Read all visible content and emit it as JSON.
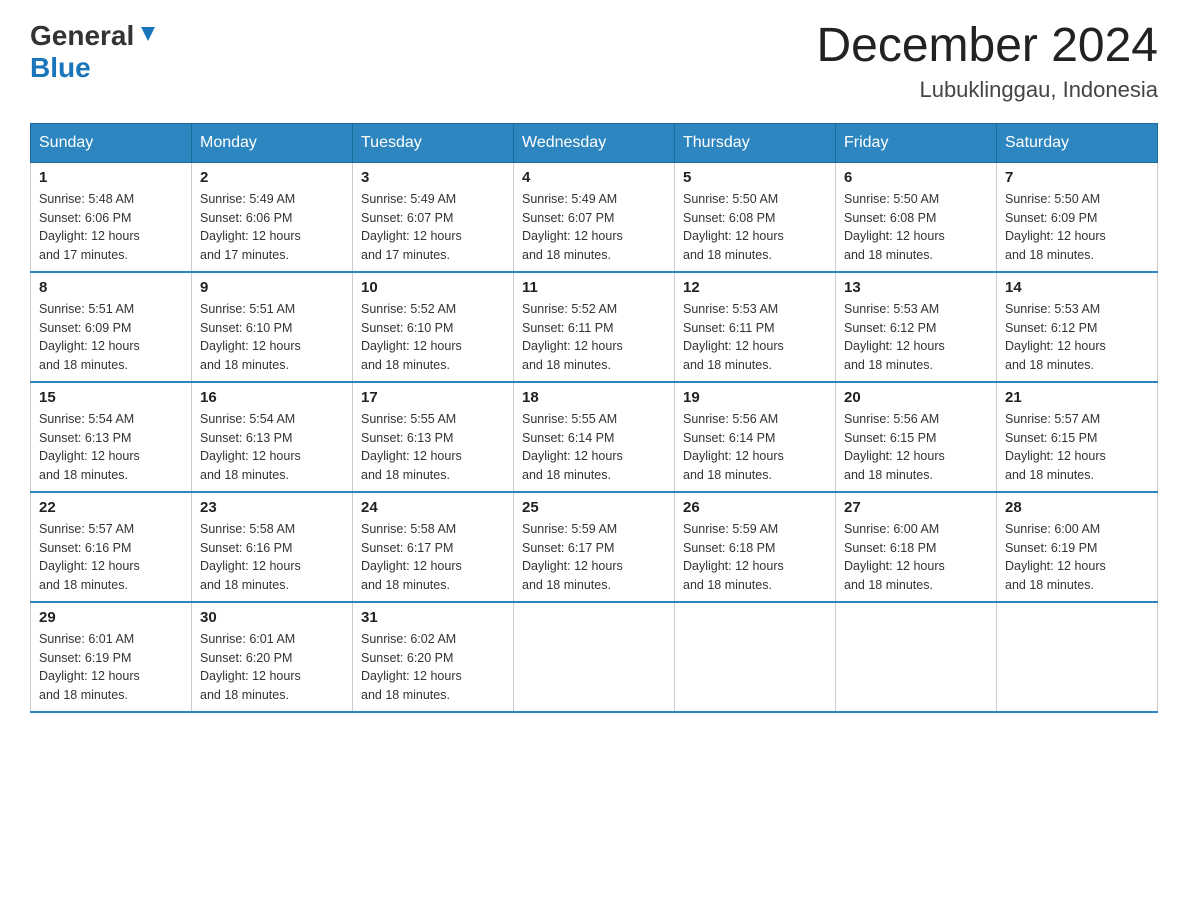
{
  "header": {
    "logo_general": "General",
    "logo_blue": "Blue",
    "month_year": "December 2024",
    "location": "Lubuklinggau, Indonesia"
  },
  "days_of_week": [
    "Sunday",
    "Monday",
    "Tuesday",
    "Wednesday",
    "Thursday",
    "Friday",
    "Saturday"
  ],
  "weeks": [
    [
      {
        "day": 1,
        "sunrise": "5:48 AM",
        "sunset": "6:06 PM",
        "daylight": "12 hours and 17 minutes."
      },
      {
        "day": 2,
        "sunrise": "5:49 AM",
        "sunset": "6:06 PM",
        "daylight": "12 hours and 17 minutes."
      },
      {
        "day": 3,
        "sunrise": "5:49 AM",
        "sunset": "6:07 PM",
        "daylight": "12 hours and 17 minutes."
      },
      {
        "day": 4,
        "sunrise": "5:49 AM",
        "sunset": "6:07 PM",
        "daylight": "12 hours and 18 minutes."
      },
      {
        "day": 5,
        "sunrise": "5:50 AM",
        "sunset": "6:08 PM",
        "daylight": "12 hours and 18 minutes."
      },
      {
        "day": 6,
        "sunrise": "5:50 AM",
        "sunset": "6:08 PM",
        "daylight": "12 hours and 18 minutes."
      },
      {
        "day": 7,
        "sunrise": "5:50 AM",
        "sunset": "6:09 PM",
        "daylight": "12 hours and 18 minutes."
      }
    ],
    [
      {
        "day": 8,
        "sunrise": "5:51 AM",
        "sunset": "6:09 PM",
        "daylight": "12 hours and 18 minutes."
      },
      {
        "day": 9,
        "sunrise": "5:51 AM",
        "sunset": "6:10 PM",
        "daylight": "12 hours and 18 minutes."
      },
      {
        "day": 10,
        "sunrise": "5:52 AM",
        "sunset": "6:10 PM",
        "daylight": "12 hours and 18 minutes."
      },
      {
        "day": 11,
        "sunrise": "5:52 AM",
        "sunset": "6:11 PM",
        "daylight": "12 hours and 18 minutes."
      },
      {
        "day": 12,
        "sunrise": "5:53 AM",
        "sunset": "6:11 PM",
        "daylight": "12 hours and 18 minutes."
      },
      {
        "day": 13,
        "sunrise": "5:53 AM",
        "sunset": "6:12 PM",
        "daylight": "12 hours and 18 minutes."
      },
      {
        "day": 14,
        "sunrise": "5:53 AM",
        "sunset": "6:12 PM",
        "daylight": "12 hours and 18 minutes."
      }
    ],
    [
      {
        "day": 15,
        "sunrise": "5:54 AM",
        "sunset": "6:13 PM",
        "daylight": "12 hours and 18 minutes."
      },
      {
        "day": 16,
        "sunrise": "5:54 AM",
        "sunset": "6:13 PM",
        "daylight": "12 hours and 18 minutes."
      },
      {
        "day": 17,
        "sunrise": "5:55 AM",
        "sunset": "6:13 PM",
        "daylight": "12 hours and 18 minutes."
      },
      {
        "day": 18,
        "sunrise": "5:55 AM",
        "sunset": "6:14 PM",
        "daylight": "12 hours and 18 minutes."
      },
      {
        "day": 19,
        "sunrise": "5:56 AM",
        "sunset": "6:14 PM",
        "daylight": "12 hours and 18 minutes."
      },
      {
        "day": 20,
        "sunrise": "5:56 AM",
        "sunset": "6:15 PM",
        "daylight": "12 hours and 18 minutes."
      },
      {
        "day": 21,
        "sunrise": "5:57 AM",
        "sunset": "6:15 PM",
        "daylight": "12 hours and 18 minutes."
      }
    ],
    [
      {
        "day": 22,
        "sunrise": "5:57 AM",
        "sunset": "6:16 PM",
        "daylight": "12 hours and 18 minutes."
      },
      {
        "day": 23,
        "sunrise": "5:58 AM",
        "sunset": "6:16 PM",
        "daylight": "12 hours and 18 minutes."
      },
      {
        "day": 24,
        "sunrise": "5:58 AM",
        "sunset": "6:17 PM",
        "daylight": "12 hours and 18 minutes."
      },
      {
        "day": 25,
        "sunrise": "5:59 AM",
        "sunset": "6:17 PM",
        "daylight": "12 hours and 18 minutes."
      },
      {
        "day": 26,
        "sunrise": "5:59 AM",
        "sunset": "6:18 PM",
        "daylight": "12 hours and 18 minutes."
      },
      {
        "day": 27,
        "sunrise": "6:00 AM",
        "sunset": "6:18 PM",
        "daylight": "12 hours and 18 minutes."
      },
      {
        "day": 28,
        "sunrise": "6:00 AM",
        "sunset": "6:19 PM",
        "daylight": "12 hours and 18 minutes."
      }
    ],
    [
      {
        "day": 29,
        "sunrise": "6:01 AM",
        "sunset": "6:19 PM",
        "daylight": "12 hours and 18 minutes."
      },
      {
        "day": 30,
        "sunrise": "6:01 AM",
        "sunset": "6:20 PM",
        "daylight": "12 hours and 18 minutes."
      },
      {
        "day": 31,
        "sunrise": "6:02 AM",
        "sunset": "6:20 PM",
        "daylight": "12 hours and 18 minutes."
      },
      null,
      null,
      null,
      null
    ]
  ],
  "labels": {
    "sunrise": "Sunrise:",
    "sunset": "Sunset:",
    "daylight": "Daylight:"
  }
}
